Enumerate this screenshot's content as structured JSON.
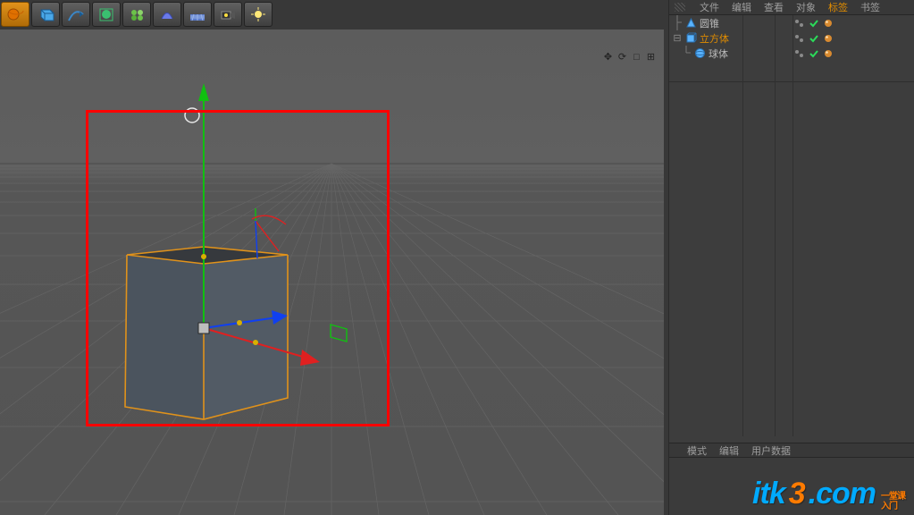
{
  "toolbar_left": [
    {
      "name": "create-object-icon"
    },
    {
      "name": "primitive-cube-icon"
    },
    {
      "name": "spline-pen-icon"
    },
    {
      "name": "generator-subdiv-icon"
    },
    {
      "name": "generator-cloner-icon"
    },
    {
      "name": "deformer-icon"
    },
    {
      "name": "environment-floor-icon"
    },
    {
      "name": "camera-icon"
    },
    {
      "name": "light-icon"
    }
  ],
  "toolbar_right": [
    {
      "name": "snap-s-icon"
    },
    {
      "name": "axis-center-icon"
    },
    {
      "name": "workplane-lock-icon"
    },
    {
      "name": "workplane-icon"
    }
  ],
  "viewport_icons": [
    {
      "glyph": "✥",
      "name": "viewport-move-icon"
    },
    {
      "glyph": "⟳",
      "name": "viewport-rotate-icon"
    },
    {
      "glyph": "□",
      "name": "viewport-zoom-icon"
    },
    {
      "glyph": "⊞",
      "name": "viewport-layout-icon"
    }
  ],
  "panel": {
    "tabs": [
      "文件",
      "编辑",
      "查看",
      "对象",
      "标签",
      "书签"
    ],
    "active_tab_index": 4,
    "bottom_tabs": [
      "模式",
      "编辑",
      "用户数据"
    ]
  },
  "objects": [
    {
      "name": "圆锥",
      "depth": 0,
      "icon": "cone",
      "selected": false,
      "has_children": false
    },
    {
      "name": "立方体",
      "depth": 0,
      "icon": "cube",
      "selected": true,
      "has_children": true,
      "expanded": true
    },
    {
      "name": "球体",
      "depth": 1,
      "icon": "sphere",
      "selected": false,
      "has_children": false
    }
  ],
  "watermark": {
    "t1": "itk",
    "t2": "3",
    "t3": ".com",
    "sub1": "一堂课",
    "sub2": "入门"
  },
  "colors": {
    "accent_orange": "#e08c00",
    "grid_light": "#676767",
    "grid_dark": "#4f4f4f",
    "cube_fill": "#4f5862",
    "cube_top": "#36393d",
    "cube_edge": "#e0921b",
    "axis_x": "#e02020",
    "axis_y": "#10c010",
    "axis_z": "#1040f0"
  }
}
